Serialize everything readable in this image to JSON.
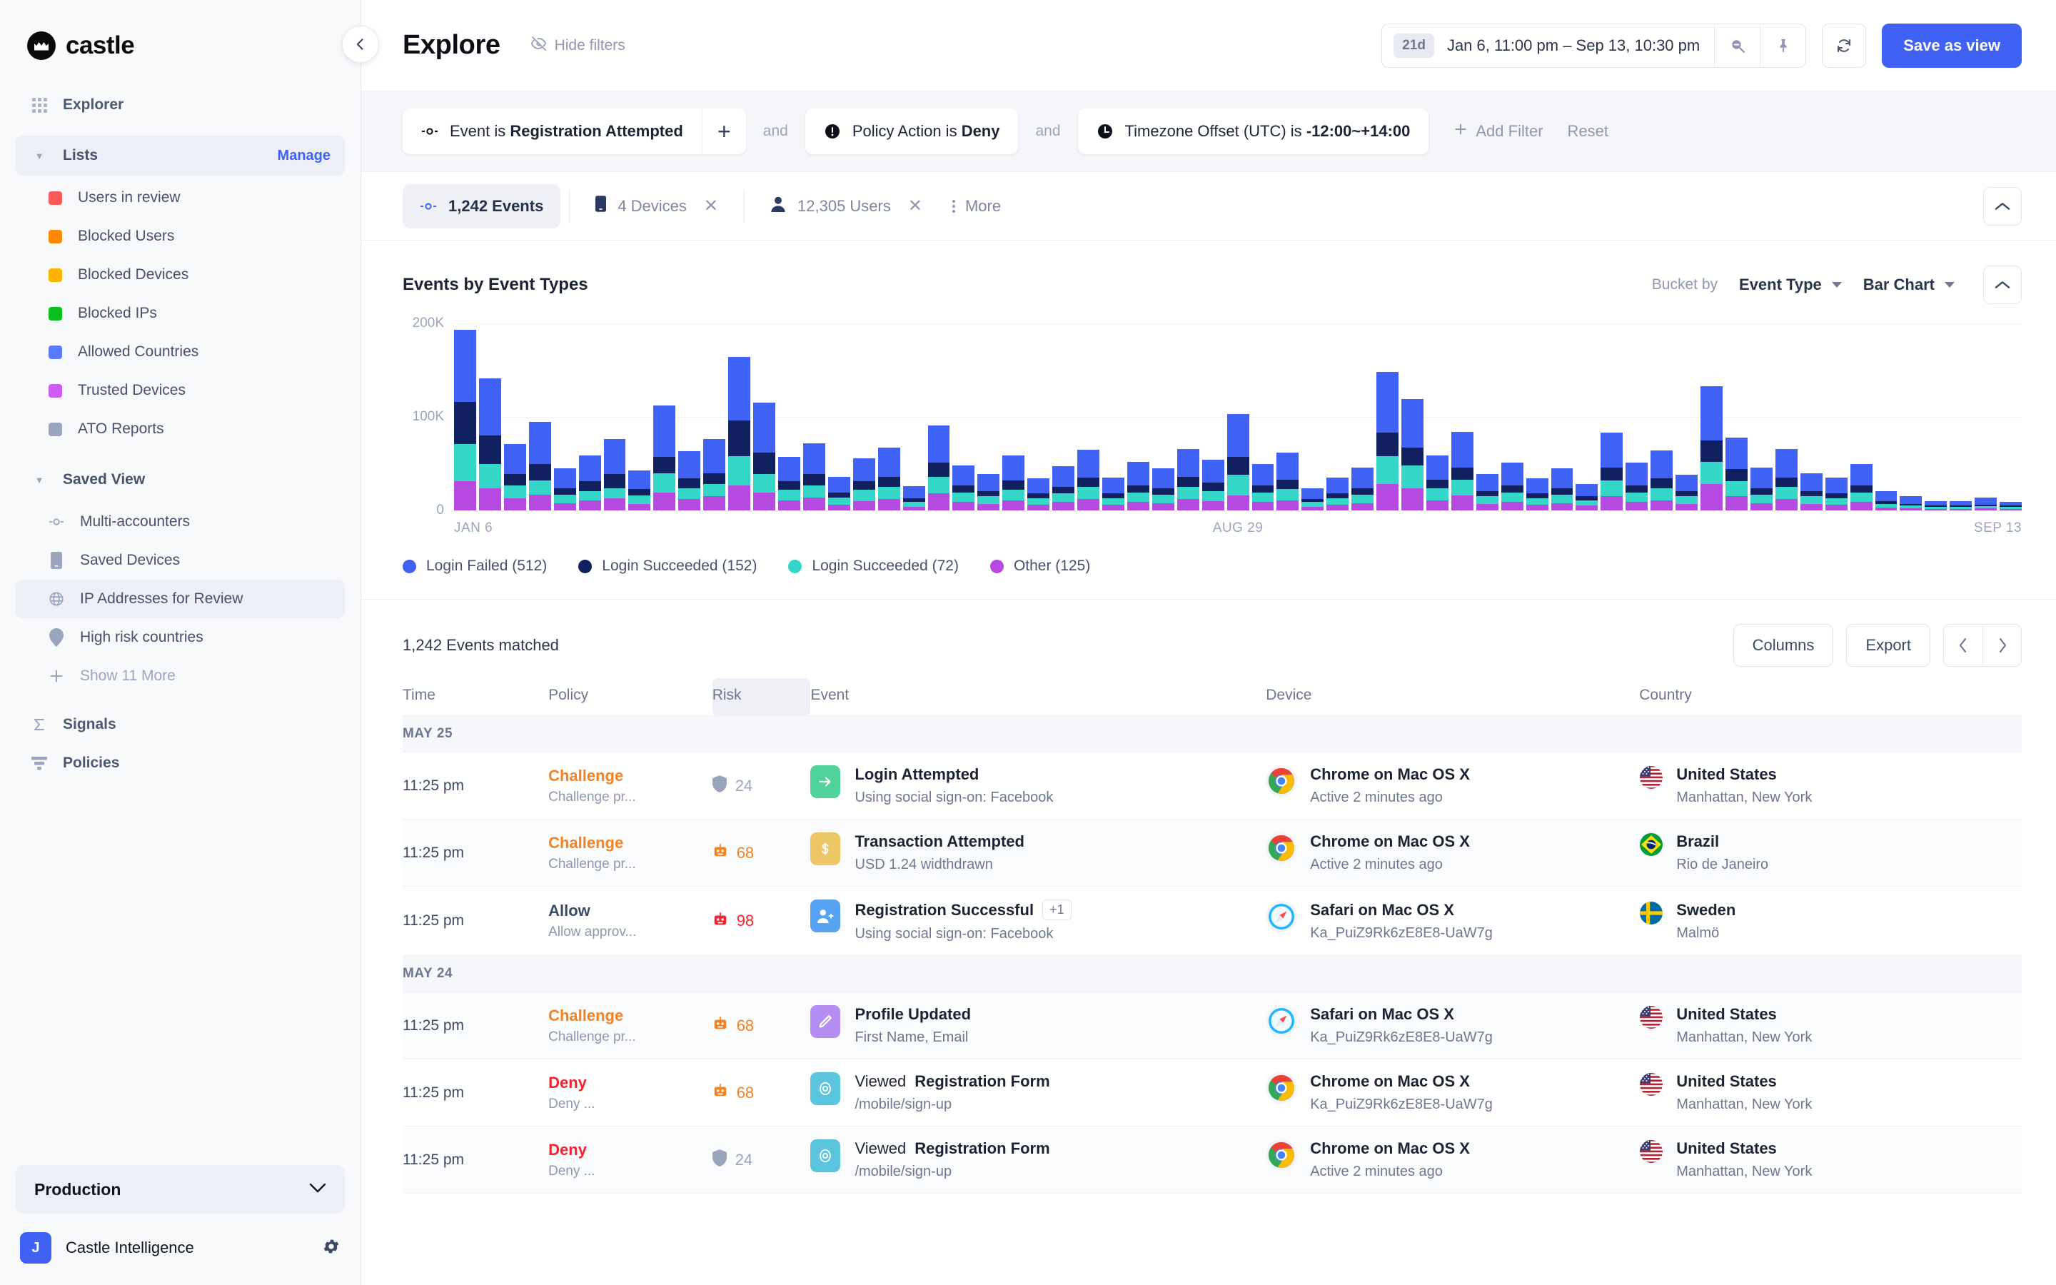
{
  "brand": {
    "name": "castle"
  },
  "sidebar": {
    "explorer": {
      "label": "Explorer",
      "icon": "grid-icon"
    },
    "lists_section": {
      "label": "Lists",
      "manage_label": "Manage"
    },
    "lists": [
      {
        "label": "Users in review",
        "color": "#fa5a5a"
      },
      {
        "label": "Blocked Users",
        "color": "#ff8a00"
      },
      {
        "label": "Blocked Devices",
        "color": "#fcb400"
      },
      {
        "label": "Blocked IPs",
        "color": "#0bbf1f"
      },
      {
        "label": "Allowed Countries",
        "color": "#5b7cfa"
      },
      {
        "label": "Trusted Devices",
        "color": "#cf5bf5"
      },
      {
        "label": "ATO Reports",
        "color": "#9aa5bd"
      }
    ],
    "saved_section": {
      "label": "Saved View"
    },
    "saved_views": [
      {
        "label": "Multi-accounters",
        "icon": "event-node-icon",
        "active": false
      },
      {
        "label": "Saved Devices",
        "icon": "device-icon",
        "active": false
      },
      {
        "label": "IP Addresses for Review",
        "icon": "globe-icon",
        "active": true
      },
      {
        "label": "High risk countries",
        "icon": "map-pin-icon",
        "active": false
      },
      {
        "label": "Show 11 More",
        "icon": "plus-icon",
        "active": false,
        "muted": true
      }
    ],
    "signals": {
      "label": "Signals",
      "icon": "sigma-icon"
    },
    "policies": {
      "label": "Policies",
      "icon": "policy-icon"
    },
    "environment": {
      "value": "Production"
    },
    "account": {
      "initial": "J",
      "name": "Castle Intelligence",
      "settings_icon": "gear-icon"
    }
  },
  "topbar": {
    "title": "Explore",
    "hide_filters_label": "Hide filters",
    "daterange": {
      "pill": "21d",
      "text": "Jan 6, 11:00 pm – Sep 13, 10:30 pm",
      "zoom_out_icon": "zoom-out-icon",
      "pin_icon": "pin-icon"
    },
    "refresh_icon": "refresh-icon",
    "save_as_view_label": "Save as view"
  },
  "filters": {
    "chips": [
      {
        "icon": "event-node-icon",
        "prefix": "Event is",
        "value": "Registration Attempted",
        "has_plus": true
      },
      {
        "icon": "alert-icon",
        "prefix": "Policy Action is",
        "value": "Deny",
        "has_plus": false
      },
      {
        "icon": "clock-icon",
        "prefix": "Timezone Offset (UTC) is",
        "value": "-12:00~+14:00",
        "has_plus": false
      }
    ],
    "and_label": "and",
    "add_filter_label": "Add Filter",
    "reset_label": "Reset"
  },
  "summary": {
    "chips": [
      {
        "icon": "event-node-icon",
        "label": "1,242 Events",
        "active": true,
        "closable": false
      },
      {
        "icon": "device-icon",
        "label": "4 Devices",
        "active": false,
        "closable": true
      },
      {
        "icon": "user-icon",
        "label": "12,305 Users",
        "active": false,
        "closable": true
      }
    ],
    "more_label": "More",
    "collapse_icon": "chevron-up-icon"
  },
  "chart": {
    "title": "Events by Event Types",
    "bucket_by_label": "Bucket by",
    "bucket_value": "Event Type",
    "chart_type_value": "Bar Chart",
    "collapse_icon": "chevron-up-icon"
  },
  "chart_data": {
    "type": "bar",
    "stacked": true,
    "title": "Events by Event Types",
    "xlabel": "",
    "ylabel": "",
    "ylim": [
      0,
      200000
    ],
    "yticks": [
      0,
      100000,
      200000
    ],
    "ytick_labels": [
      "0",
      "100K",
      "200K"
    ],
    "grid": true,
    "legend_position": "bottom",
    "x_tick_labels": [
      "JAN 6",
      "AUG 29",
      "SEP 13"
    ],
    "series": [
      {
        "name": "Other (125)",
        "label": "Other",
        "count": 125,
        "color": "#b64ae0",
        "values": [
          31000,
          24000,
          13000,
          17000,
          8000,
          11000,
          13000,
          7000,
          19000,
          12000,
          15000,
          27000,
          19000,
          11000,
          14000,
          6000,
          10000,
          12000,
          4000,
          18000,
          9000,
          7000,
          11000,
          6000,
          9000,
          12000,
          6000,
          9000,
          8000,
          12000,
          10000,
          16000,
          9000,
          11000,
          4000,
          6000,
          8000,
          28000,
          24000,
          11000,
          16000,
          7000,
          9000,
          6000,
          8000,
          5000,
          15000,
          9000,
          11000,
          7000,
          28000,
          15000,
          8000,
          12000,
          7000,
          6000,
          9000,
          3000,
          2000,
          1500,
          1500,
          2000,
          1500
        ]
      },
      {
        "name": "Login Succeeded (72)",
        "label": "Login Succeeded",
        "count": 72,
        "color": "#34d6c8",
        "values": [
          40000,
          26000,
          14000,
          15000,
          9000,
          10000,
          11000,
          9000,
          21000,
          12000,
          13000,
          31000,
          20000,
          11000,
          13000,
          8000,
          12000,
          13000,
          5000,
          18000,
          10000,
          8000,
          11000,
          7000,
          9000,
          13000,
          7000,
          10000,
          9000,
          13000,
          11000,
          22000,
          10000,
          12000,
          5000,
          7000,
          9000,
          30000,
          24000,
          13000,
          17000,
          8000,
          10000,
          7000,
          9000,
          6000,
          17000,
          10000,
          13000,
          8000,
          24000,
          16000,
          9000,
          13000,
          8000,
          7000,
          10000,
          4000,
          3000,
          2000,
          2000,
          2500,
          2000
        ]
      },
      {
        "name": "Login Succeeded (152)",
        "label": "Login Succeeded",
        "count": 152,
        "color": "#11205e",
        "values": [
          45000,
          30000,
          12000,
          18000,
          7000,
          10000,
          15000,
          7000,
          17000,
          10000,
          12000,
          38000,
          23000,
          9000,
          12000,
          5000,
          9000,
          11000,
          4000,
          15000,
          8000,
          6000,
          10000,
          5000,
          7000,
          10000,
          5000,
          8000,
          7000,
          11000,
          9000,
          19000,
          8000,
          10000,
          3000,
          5000,
          7000,
          25000,
          19000,
          9000,
          13000,
          6000,
          8000,
          5000,
          7000,
          4000,
          14000,
          8000,
          10000,
          6000,
          23000,
          13000,
          7000,
          10000,
          6000,
          5000,
          8000,
          3000,
          2000,
          1500,
          1500,
          2000,
          1500
        ]
      },
      {
        "name": "Login Failed (512)",
        "label": "Login Failed",
        "count": 512,
        "color": "#3f62f5",
        "values": [
          77000,
          61000,
          32000,
          45000,
          21000,
          28000,
          37000,
          20000,
          55000,
          29000,
          36000,
          68000,
          53000,
          26000,
          33000,
          17000,
          25000,
          31000,
          13000,
          40000,
          21000,
          18000,
          27000,
          16000,
          22000,
          30000,
          17000,
          25000,
          21000,
          30000,
          24000,
          46000,
          23000,
          29000,
          12000,
          17000,
          22000,
          65000,
          52000,
          26000,
          38000,
          18000,
          24000,
          16000,
          21000,
          13000,
          37000,
          24000,
          30000,
          17000,
          58000,
          34000,
          22000,
          31000,
          19000,
          17000,
          23000,
          11000,
          8000,
          5000,
          5000,
          7000,
          4000
        ]
      }
    ],
    "legend": [
      {
        "label": "Login Failed (512)",
        "color": "#3f62f5"
      },
      {
        "label": "Login Succeeded (152)",
        "color": "#11205e"
      },
      {
        "label": "Login Succeeded (72)",
        "color": "#34d6c8"
      },
      {
        "label": "Other (125)",
        "color": "#b64ae0"
      }
    ]
  },
  "table": {
    "matched_label": "1,242 Events matched",
    "columns_label": "Columns",
    "export_label": "Export",
    "prev_icon": "chevron-left-icon",
    "next_icon": "chevron-right-icon",
    "headers": [
      "Time",
      "Policy",
      "Risk",
      "Event",
      "Device",
      "Country"
    ],
    "groups": [
      {
        "date": "MAY 25",
        "rows": [
          {
            "time": "11:25 pm",
            "policy": "Challenge",
            "policy_kind": "challenge",
            "policy_sub": "Challenge pr...",
            "risk": "24",
            "risk_kind": "low",
            "risk_icon": "shield-icon",
            "event_lead": "",
            "event_title": "Login Attempted",
            "event_badge": "",
            "event_sub": "Using social sign-on: Facebook",
            "event_icon": "arrow-right-icon",
            "event_icon_color": "#4fd39b",
            "device": "Chrome on Mac OS X",
            "device_sub": "Active 2 minutes ago",
            "browser": "chrome",
            "country": "United States",
            "country_sub": "Manhattan, New York",
            "flag": "us"
          },
          {
            "time": "11:25 pm",
            "policy": "Challenge",
            "policy_kind": "challenge",
            "policy_sub": "Challenge pr...",
            "risk": "68",
            "risk_kind": "mid",
            "risk_icon": "bot-icon",
            "event_lead": "",
            "event_title": "Transaction Attempted",
            "event_badge": "",
            "event_sub": "USD 1.24 widthdrawn",
            "event_icon": "dollar-icon",
            "event_icon_color": "#edc765",
            "device": "Chrome on Mac OS X",
            "device_sub": "Active 2 minutes ago",
            "browser": "chrome",
            "country": "Brazil",
            "country_sub": "Rio de Janeiro",
            "flag": "br"
          },
          {
            "time": "11:25 pm",
            "policy": "Allow",
            "policy_kind": "allow",
            "policy_sub": "Allow approv...",
            "risk": "98",
            "risk_kind": "high",
            "risk_icon": "bot-icon",
            "event_lead": "",
            "event_title": "Registration Successful",
            "event_badge": "+1",
            "event_sub": "Using social sign-on: Facebook",
            "event_icon": "user-add-icon",
            "event_icon_color": "#57a3f3",
            "device": "Safari on Mac OS X",
            "device_sub": "Ka_PuiZ9Rk6zE8E8-UaW7g",
            "browser": "safari",
            "country": "Sweden",
            "country_sub": "Malmö",
            "flag": "se"
          }
        ]
      },
      {
        "date": "MAY 24",
        "rows": [
          {
            "time": "11:25 pm",
            "policy": "Challenge",
            "policy_kind": "challenge",
            "policy_sub": "Challenge pr...",
            "risk": "68",
            "risk_kind": "mid",
            "risk_icon": "bot-icon",
            "event_lead": "",
            "event_title": "Profile Updated",
            "event_badge": "",
            "event_sub": "First Name, Email",
            "event_icon": "pencil-icon",
            "event_icon_color": "#b58cf2",
            "device": "Safari on Mac OS X",
            "device_sub": "Ka_PuiZ9Rk6zE8E8-UaW7g",
            "browser": "safari",
            "country": "United States",
            "country_sub": "Manhattan, New York",
            "flag": "us"
          },
          {
            "time": "11:25 pm",
            "policy": "Deny",
            "policy_kind": "deny",
            "policy_sub": "Deny ...",
            "risk": "68",
            "risk_kind": "mid",
            "risk_icon": "bot-icon",
            "event_lead": "Viewed",
            "event_title": "Registration Form",
            "event_badge": "",
            "event_sub": "/mobile/sign-up",
            "event_icon": "eye-icon",
            "event_icon_color": "#5bc5de",
            "device": "Chrome on Mac OS X",
            "device_sub": "Ka_PuiZ9Rk6zE8E8-UaW7g",
            "browser": "chrome",
            "country": "United States",
            "country_sub": "Manhattan, New York",
            "flag": "us"
          },
          {
            "time": "11:25 pm",
            "policy": "Deny",
            "policy_kind": "deny",
            "policy_sub": "Deny ...",
            "risk": "24",
            "risk_kind": "low",
            "risk_icon": "shield-icon",
            "event_lead": "Viewed",
            "event_title": "Registration Form",
            "event_badge": "",
            "event_sub": "/mobile/sign-up",
            "event_icon": "eye-icon",
            "event_icon_color": "#5bc5de",
            "device": "Chrome on Mac OS X",
            "device_sub": "Active 2 minutes ago",
            "browser": "chrome",
            "country": "United States",
            "country_sub": "Manhattan, New York",
            "flag": "us"
          }
        ]
      }
    ]
  }
}
